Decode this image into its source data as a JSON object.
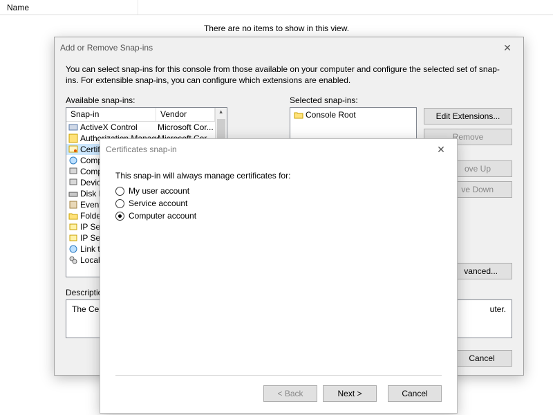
{
  "mmc": {
    "column_name": "Name",
    "empty_msg": "There are no items to show in this view."
  },
  "snapins": {
    "title": "Add or Remove Snap-ins",
    "intro": "You can select snap-ins for this console from those available on your computer and configure the selected set of snap-ins. For extensible snap-ins, you can configure which extensions are enabled.",
    "available_label": "Available snap-ins:",
    "selected_label": "Selected snap-ins:",
    "col_snapin": "Snap-in",
    "col_vendor": "Vendor",
    "items": [
      {
        "name": "ActiveX Control",
        "vendor": "Microsoft Cor..."
      },
      {
        "name": "Authorization Manager",
        "vendor": "Microsoft Cor..."
      },
      {
        "name": "Certificates",
        "vendor": ""
      },
      {
        "name": "Component Services",
        "vendor": ""
      },
      {
        "name": "Computer Management",
        "vendor": ""
      },
      {
        "name": "Device Manager",
        "vendor": ""
      },
      {
        "name": "Disk Management",
        "vendor": ""
      },
      {
        "name": "Event Viewer",
        "vendor": ""
      },
      {
        "name": "Folder",
        "vendor": ""
      },
      {
        "name": "IP Security Monitor",
        "vendor": ""
      },
      {
        "name": "IP Security Policy",
        "vendor": ""
      },
      {
        "name": "Link to Web Address",
        "vendor": ""
      },
      {
        "name": "Local Users and Groups",
        "vendor": ""
      }
    ],
    "items_trunc": [
      "ActiveX Control",
      "Authorization Manager",
      "Certifi",
      "Compo",
      "Compu",
      "Device",
      "Disk M",
      "Event",
      "Folder",
      "IP Sec",
      "IP Sec",
      "Link to",
      "Local U"
    ],
    "selected_root": "Console Root",
    "btn_edit_ext": "Edit Extensions...",
    "btn_remove": "Remove",
    "btn_move_up_tail": "ove Up",
    "btn_move_down_tail": "ve Down",
    "btn_advanced_tail": "vanced...",
    "desc_label": "Description",
    "desc_text_left": "The Certifi",
    "desc_text_right": "uter.",
    "btn_cancel": "Cancel"
  },
  "cert": {
    "title": "Certificates snap-in",
    "prompt": "This snap-in will always manage certificates for:",
    "opt_user": "My user account",
    "opt_service": "Service account",
    "opt_computer": "Computer account",
    "btn_back": "< Back",
    "btn_next": "Next >",
    "btn_cancel": "Cancel"
  }
}
